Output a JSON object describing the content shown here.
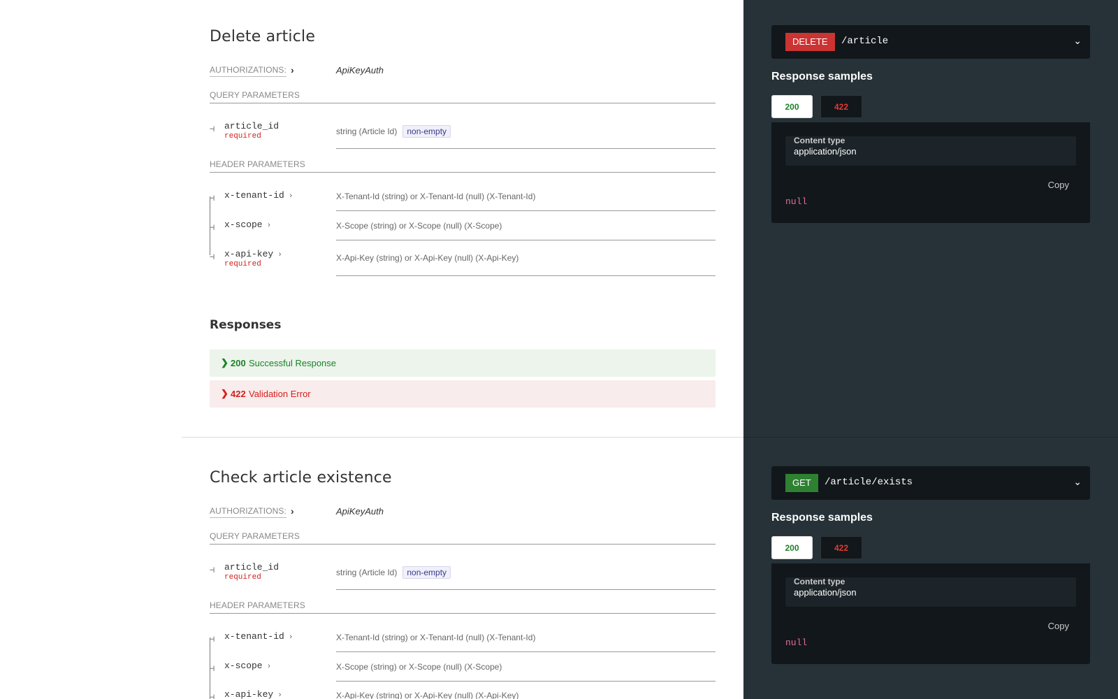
{
  "operations": [
    {
      "title": "Delete article",
      "authorizations_label": "AUTHORIZATIONS:",
      "auth_value": "ApiKeyAuth",
      "query_group_title": "QUERY PARAMETERS",
      "query_params": [
        {
          "name": "article_id",
          "required": "required",
          "type": "string (Article Id)",
          "badge": "non-empty"
        }
      ],
      "header_group_title": "HEADER PARAMETERS",
      "header_params": [
        {
          "name": "x-tenant-id",
          "required": "",
          "type": "X-Tenant-Id (string) or X-Tenant-Id (null) (X-Tenant-Id)"
        },
        {
          "name": "x-scope",
          "required": "",
          "type": "X-Scope (string) or X-Scope (null) (X-Scope)"
        },
        {
          "name": "x-api-key",
          "required": "required",
          "type": "X-Api-Key (string) or X-Api-Key (null) (X-Api-Key)"
        }
      ],
      "responses_title": "Responses",
      "responses": [
        {
          "code": "200",
          "text": "Successful Response"
        },
        {
          "code": "422",
          "text": "Validation Error"
        }
      ],
      "endpoint": {
        "method": "DELETE",
        "path": "/article"
      },
      "samples_title": "Response samples",
      "tabs": [
        "200",
        "422"
      ],
      "content_type_label": "Content type",
      "content_type_value": "application/json",
      "copy_label": "Copy",
      "sample_body": "null"
    },
    {
      "title": "Check article existence",
      "authorizations_label": "AUTHORIZATIONS:",
      "auth_value": "ApiKeyAuth",
      "query_group_title": "QUERY PARAMETERS",
      "query_params": [
        {
          "name": "article_id",
          "required": "required",
          "type": "string (Article Id)",
          "badge": "non-empty"
        }
      ],
      "header_group_title": "HEADER PARAMETERS",
      "header_params": [
        {
          "name": "x-tenant-id",
          "required": "",
          "type": "X-Tenant-Id (string) or X-Tenant-Id (null) (X-Tenant-Id)"
        },
        {
          "name": "x-scope",
          "required": "",
          "type": "X-Scope (string) or X-Scope (null) (X-Scope)"
        },
        {
          "name": "x-api-key",
          "required": "",
          "type": "X-Api-Key (string) or X-Api-Key (null) (X-Api-Key)"
        }
      ],
      "endpoint": {
        "method": "GET",
        "path": "/article/exists"
      },
      "samples_title": "Response samples",
      "tabs": [
        "200",
        "422"
      ],
      "content_type_label": "Content type",
      "content_type_value": "application/json",
      "copy_label": "Copy",
      "sample_body": "null"
    }
  ],
  "icons": {
    "chevron_right": "›",
    "chevron_bold": "❯",
    "chevron_down": "⌄",
    "tree_branch": "⊣"
  },
  "colors": {
    "delete": "#cc3333",
    "get": "#2f8132",
    "success": "#1d8127",
    "error": "#d41f1c",
    "right_panel": "#263238"
  }
}
